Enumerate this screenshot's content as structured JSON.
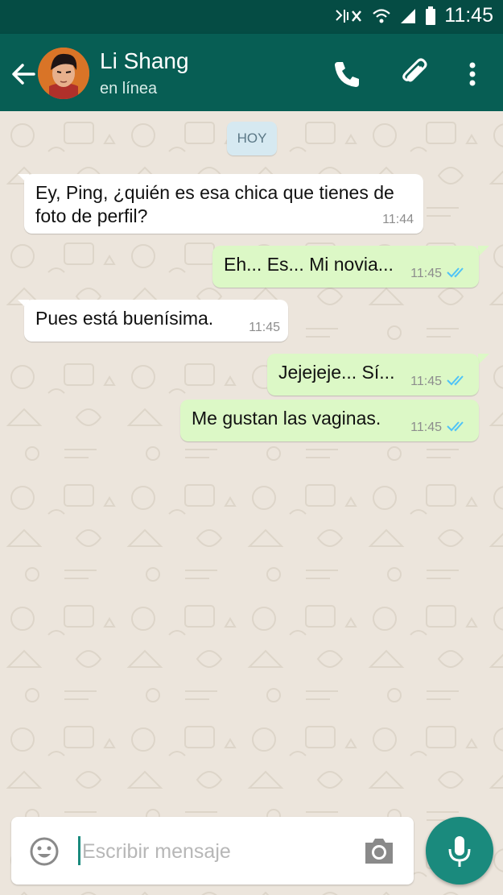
{
  "status_bar": {
    "time": "11:45"
  },
  "header": {
    "contact_name": "Li Shang",
    "contact_status": "en línea",
    "actions": [
      "call-icon",
      "attach-icon",
      "more-vert-icon"
    ]
  },
  "chat": {
    "date_chip": "HOY",
    "messages": [
      {
        "direction": "incoming",
        "text": "Ey, Ping, ¿quién es esa chica que tienes de\nfoto de perfil?",
        "time": "11:44"
      },
      {
        "direction": "outgoing",
        "text": "Eh... Es... Mi novia...",
        "time": "11:45",
        "read": true
      },
      {
        "direction": "incoming",
        "text": "Pues está buenísima.",
        "time": "11:45"
      },
      {
        "direction": "outgoing",
        "text": "Jejejeje... Sí...",
        "time": "11:45",
        "read": true
      },
      {
        "direction": "outgoing",
        "text": "Me gustan las vaginas.",
        "time": "11:45",
        "read": true
      }
    ]
  },
  "composer": {
    "placeholder": "Escribir mensaje",
    "value": ""
  },
  "colors": {
    "status_bar": "#054c44",
    "app_bar": "#075e54",
    "outgoing_bubble": "#dcf8c6",
    "incoming_bubble": "#ffffff",
    "read_ticks": "#4fc3f7",
    "accent": "#1a8a7d"
  }
}
